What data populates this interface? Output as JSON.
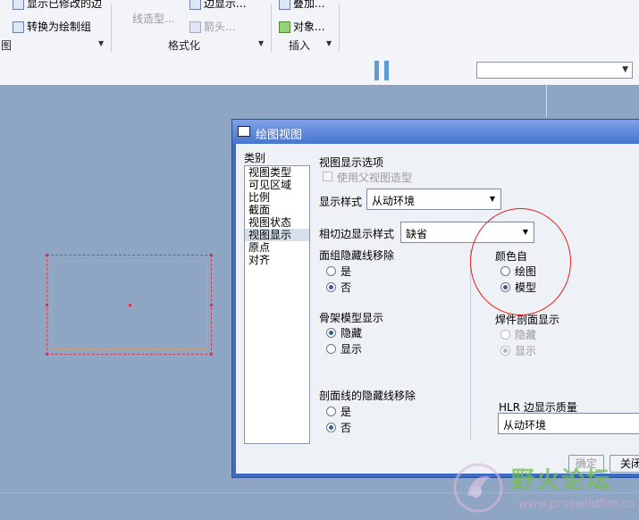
{
  "ribbon": {
    "items": {
      "show_modified": "显示已修改的边",
      "convert_group": "转换为绘制组",
      "line_style": "线造型...",
      "arrow": "箭头...",
      "edge_display": "边显示...",
      "overlay": "叠加...",
      "object": "对象..."
    },
    "groups": {
      "view": "图",
      "format": "格式化",
      "insert": "插入"
    }
  },
  "dialog": {
    "title": "绘图视图",
    "category_label": "类别",
    "categories": [
      "视图类型",
      "可见区域",
      "比例",
      "截面",
      "视图状态",
      "视图显示",
      "原点",
      "对齐"
    ],
    "selected_category": "视图显示",
    "section_title": "视图显示选项",
    "use_parent_style": "使用父视图造型",
    "display_style_label": "显示样式",
    "display_style_value": "从动环境",
    "tangent_label": "相切边显示样式",
    "tangent_value": "缺省",
    "face_group": {
      "title": "面组隐藏线移除",
      "yes": "是",
      "no": "否",
      "selected": "否"
    },
    "color_from": {
      "title": "颜色自",
      "drawing": "绘图",
      "model": "模型",
      "selected": "模型"
    },
    "skeleton": {
      "title": "骨架模型显示",
      "hide": "隐藏",
      "show": "显示",
      "selected": "隐藏"
    },
    "weld": {
      "title": "焊件剖面显示",
      "hide": "隐藏",
      "show": "显示",
      "selected": "显示"
    },
    "section_line": {
      "title": "剖面线的隐藏线移除",
      "yes": "是",
      "no": "否",
      "selected": "否"
    },
    "hlr_label": "HLR 边显示质量",
    "hlr_value": "从动环境",
    "ok_button": "确定",
    "close_button": "关闭"
  },
  "watermark": {
    "main": "野火论坛",
    "url": "www.proewildfire.cn"
  },
  "colors": {
    "canvas": "#8ea5c3",
    "dialog_frame": "#3e6cc2",
    "highlight_circle": "#e02020",
    "view_border": "#d83b4d"
  }
}
